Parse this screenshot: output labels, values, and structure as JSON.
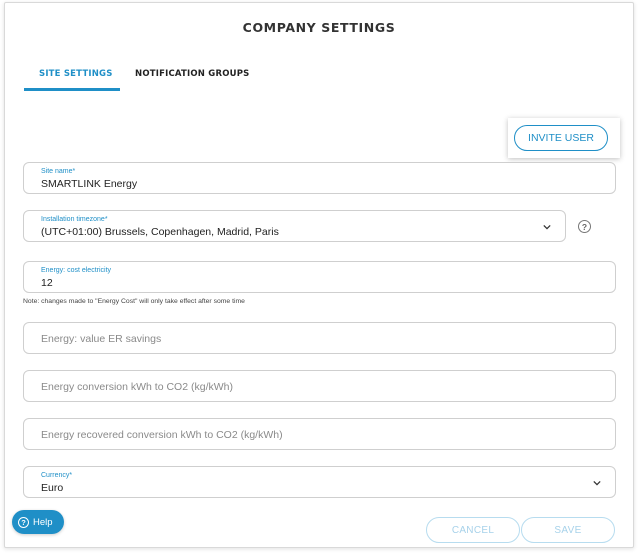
{
  "dialog": {
    "title": "COMPANY SETTINGS"
  },
  "tabs": [
    {
      "label": "SITE SETTINGS",
      "active": true
    },
    {
      "label": "NOTIFICATION GROUPS",
      "active": false
    }
  ],
  "invite_user_label": "INVITE USER",
  "fields": {
    "site_name": {
      "label": "Site name*",
      "value": "SMARTLINK Energy"
    },
    "timezone": {
      "label": "Installation timezone*",
      "value": "(UTC+01:00) Brussels, Copenhagen, Madrid, Paris"
    },
    "cost_electricity": {
      "label": "Energy: cost electricity",
      "value": "12"
    },
    "er_savings": {
      "placeholder": "Energy: value ER savings"
    },
    "conversion_co2": {
      "placeholder": "Energy conversion kWh to CO2 (kg/kWh)"
    },
    "recovered_co2": {
      "placeholder": "Energy recovered conversion kWh to CO2 (kg/kWh)"
    },
    "currency": {
      "label": "Currency*",
      "value": "Euro"
    }
  },
  "note": "Note: changes made to \"Energy Cost\" will only take effect after some time",
  "help_label": "Help",
  "timezone_help_icon": "question-circle-icon",
  "footer": {
    "cancel_label": "CANCEL",
    "save_label": "SAVE"
  },
  "colors": {
    "accent": "#1f8fc7",
    "disabled": "#a7d2ea",
    "border": "#cfcfcf"
  }
}
